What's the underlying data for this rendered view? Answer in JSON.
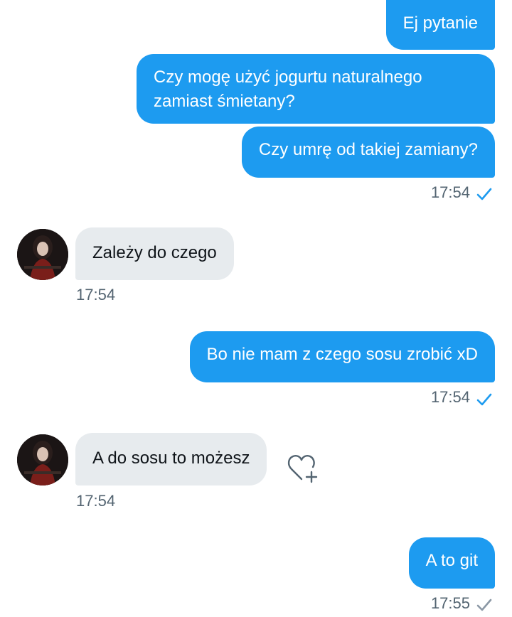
{
  "messages": [
    {
      "side": "sent",
      "text": "Ej pytanie"
    },
    {
      "side": "sent",
      "text": "Czy mogę użyć jogurtu naturalnego zamiast śmietany?"
    },
    {
      "side": "sent",
      "text": "Czy umrę od takiej zamiany?"
    },
    {
      "side": "received",
      "text": "Zależy do czego"
    },
    {
      "side": "sent",
      "text": "Bo nie mam z czego sosu zrobić xD"
    },
    {
      "side": "received",
      "text": "A do sosu to możesz"
    },
    {
      "side": "sent",
      "text": "A to git"
    }
  ],
  "timestamps": [
    "17:54",
    "17:54",
    "17:54",
    "17:54",
    "17:55"
  ],
  "icons": {
    "read": "check-icon",
    "avatar": "avatar",
    "react": "heart-plus-icon"
  },
  "colors": {
    "sent_bubble": "#1d9bf0",
    "received_bubble": "#e7ebee",
    "check_read": "#1d9bf0",
    "check_sent": "#8b98a5",
    "timestamp": "#536471"
  }
}
